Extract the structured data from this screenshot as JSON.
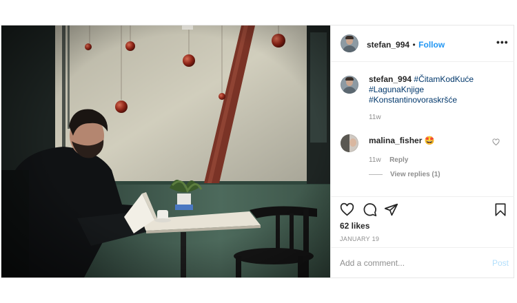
{
  "post": {
    "author": {
      "username": "stefan_994",
      "follow_label": "Follow",
      "separator": "•"
    },
    "caption": {
      "username": "stefan_994",
      "hashtags": [
        "#ČitamKodKuće",
        "#LagunaKnjige",
        "#Konstantinovoraskršće"
      ],
      "time": "11w"
    },
    "comments": [
      {
        "username": "malina_fisher",
        "text": "🤩",
        "time": "11w",
        "reply_label": "Reply",
        "view_replies_label": "View replies (1)"
      }
    ],
    "likes_label": "62 likes",
    "date_label": "JANUARY 19",
    "add_comment_placeholder": "Add a comment...",
    "post_button_label": "Post",
    "more_options_glyph": "•••"
  },
  "icons": {
    "more_options": "more-options-icon",
    "like": "heart-icon",
    "comment": "comment-icon",
    "share": "share-icon",
    "save": "bookmark-icon",
    "comment_like": "small-heart-icon"
  },
  "colors": {
    "link_blue": "#2196f3",
    "hashtag": "#00376b",
    "muted": "#8e8e8e",
    "post_disabled": "#b2dffc",
    "border": "#efefef"
  }
}
